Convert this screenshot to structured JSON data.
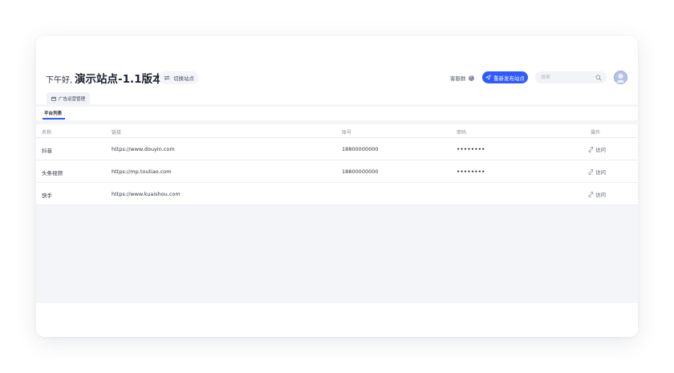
{
  "header": {
    "greeting": "下午好,",
    "site_title": "演示站点-1.1版本",
    "switch_site_label": "切换站点",
    "help_label": "客服群",
    "publish_label": "重新发布站点",
    "search_placeholder": "搜索"
  },
  "tabs": {
    "main_tab_label": "广告运营管理",
    "sub_tab_label": "平台列表"
  },
  "table": {
    "columns": {
      "name": "名称",
      "link": "链接",
      "account": "账号",
      "password": "密码",
      "action": "操作"
    },
    "rows": [
      {
        "name": "抖音",
        "link": "https://www.douyin.com",
        "account": "18800000000",
        "password": "••••••••",
        "action": "访问"
      },
      {
        "name": "头条视频",
        "link": "https://mp.toutiao.com",
        "account": "18800000000",
        "password": "••••••••",
        "action": "访问"
      },
      {
        "name": "快手",
        "link": "https://www.kuaishou.com",
        "account": "",
        "password": "",
        "action": "访问"
      }
    ]
  },
  "colors": {
    "accent": "#2e5bff",
    "page_background": "#f4f5f9",
    "avatar": "#b7c1e8"
  }
}
